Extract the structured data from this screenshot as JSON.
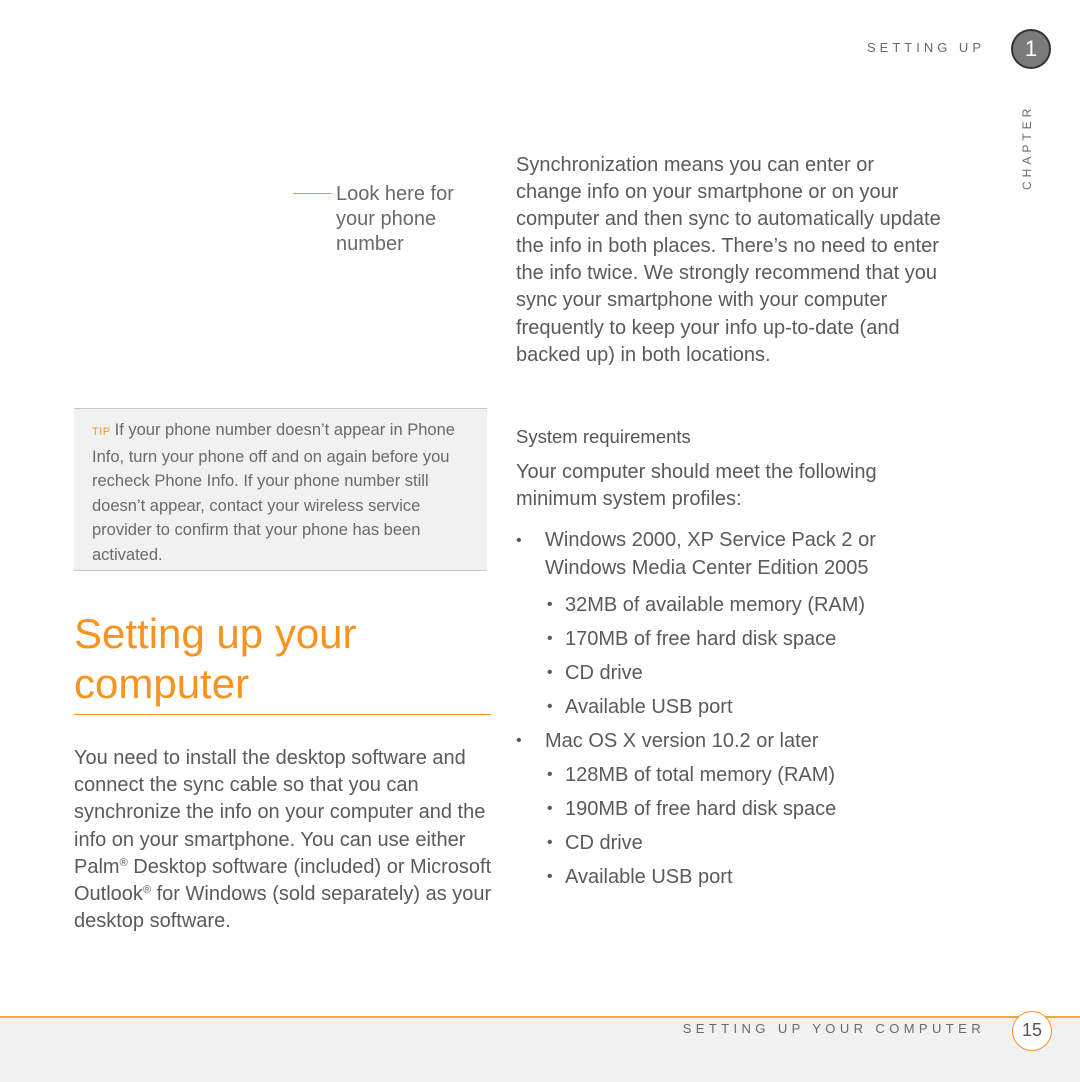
{
  "header": {
    "running_head": "SETTING UP",
    "chapter_number": "1",
    "chapter_label": "CHAPTER"
  },
  "callout": {
    "text": "Look here for your phone number"
  },
  "tip": {
    "label": "TIP",
    "text": "If your phone number doesn’t appear in Phone Info, turn your phone off and on again before you recheck Phone Info. If your phone number still doesn’t appear, contact your wireless service provider to confirm that your phone has been activated."
  },
  "section": {
    "title": "Setting up your computer",
    "body_part1": "You need to install the desktop software and connect the sync cable so that you can synchronize the info on your computer and the info on your smartphone. You can use either Palm",
    "registered1": "®",
    "body_part2": " Desktop software (included) or Microsoft Outlook",
    "registered2": "®",
    "body_part3": " for Windows (sold separately) as your desktop software."
  },
  "sync_paragraph": "Synchronization means you can enter or change info on your smartphone or on your computer and then sync to automatically update the info in both places. There’s no need to enter the info twice. We strongly recommend that you sync your smartphone with your computer frequently to keep your info up-to-date (and backed up) in both locations.",
  "requirements": {
    "heading": "System requirements",
    "intro": "Your computer should meet the following minimum system profiles:",
    "bullet": "•",
    "platforms": [
      {
        "name": "Windows 2000, XP Service Pack 2 or Windows Media Center Edition 2005",
        "items": [
          "32MB of available memory (RAM)",
          "170MB of free hard disk space",
          "CD drive",
          "Available USB port"
        ]
      },
      {
        "name": "Mac OS X version 10.2 or later",
        "items": [
          "128MB of total memory (RAM)",
          "190MB of free hard disk space",
          "CD drive",
          "Available USB port"
        ]
      }
    ]
  },
  "footer": {
    "section_name": "SETTING UP YOUR COMPUTER",
    "page_number": "15"
  },
  "colors": {
    "accent": "#f7931e",
    "text": "#5a5a5a",
    "tip_background": "#f1f1f1"
  }
}
